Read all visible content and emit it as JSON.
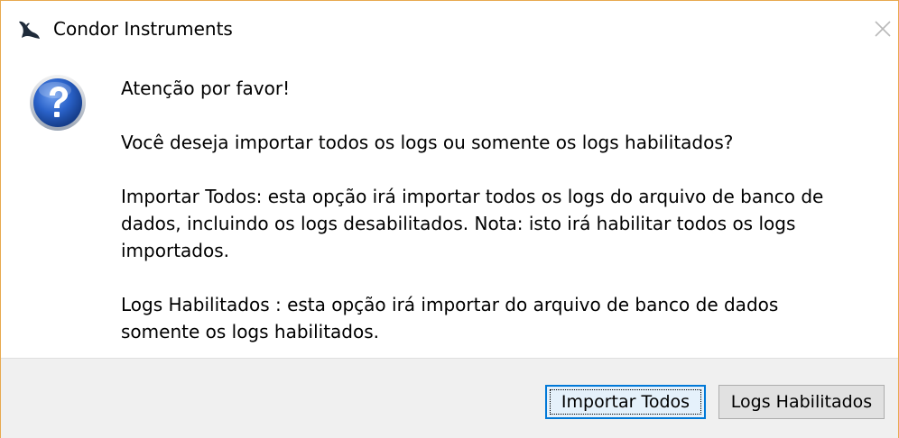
{
  "window": {
    "title": "Condor Instruments",
    "close_glyph": "✕"
  },
  "icons": {
    "app_icon": "condor-bird-icon",
    "message_icon": "question-mark-icon",
    "close_icon": "close-icon"
  },
  "message": {
    "line1": "Atenção por favor!",
    "line2": "Você deseja importar todos os logs ou somente os logs habilitados?",
    "line3": "Importar Todos: esta opção irá importar todos os logs do arquivo de banco de\ndados, incluindo os logs desabilitados. Nota: isto irá habilitar todos os logs\nimportados.",
    "line4": "Logs Habilitados : esta opção irá importar do arquivo de banco de dados\nsomente os logs habilitados."
  },
  "buttons": {
    "import_all": "Importar Todos",
    "enabled_logs": "Logs Habilitados"
  },
  "colors": {
    "window_border": "#e8a94f",
    "footer_bg": "#f0f0f0",
    "primary_border": "#0078d7",
    "question_icon_blue": "#2a62c9"
  }
}
